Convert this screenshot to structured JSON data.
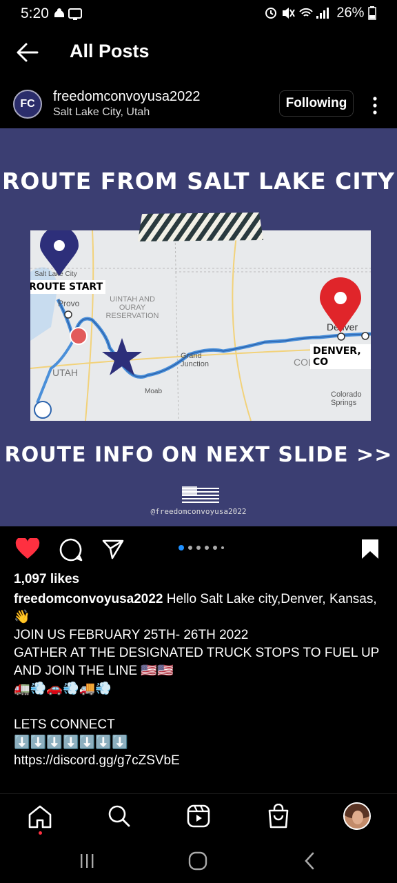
{
  "status_bar": {
    "time": "5:20",
    "battery": "26%"
  },
  "header": {
    "title": "All Posts",
    "back_icon": "arrow-left-icon"
  },
  "post_header": {
    "avatar_initials": "FC",
    "username": "freedomconvoyusa2022",
    "location": "Salt Lake City, Utah",
    "follow_label": "Following",
    "more_icon": "kebab-icon"
  },
  "post_image": {
    "headline_top": "ROUTE FROM SALT LAKE CITY",
    "headline_bottom": "ROUTE INFO ON NEXT SLIDE >>",
    "start_badge": "ROUTE START",
    "end_badge": "DENVER, CO",
    "watermark": "@freedomconvoyusa2022",
    "map_labels": {
      "salt_lake": "Salt Lake City",
      "provo": "Provo",
      "reservation": "UINTAH AND OURAY RESERVATION",
      "utah": "UTAH",
      "grand_junction": "Grand Junction",
      "moab": "Moab",
      "denver": "Denver",
      "colorado": "COLORADO",
      "colorado_springs": "Colorado Springs"
    },
    "colors": {
      "background": "#3b3e72",
      "route": "#4a8fd9",
      "start_pin": "#2d2f7a",
      "end_pin": "#e0252a",
      "star": "#2d2f7a"
    }
  },
  "actions": {
    "like_icon": "heart-icon",
    "comment_icon": "comment-icon",
    "share_icon": "send-icon",
    "save_icon": "bookmark-icon",
    "carousel": {
      "total": 6,
      "active": 1
    }
  },
  "likes": "1,097 likes",
  "caption": {
    "username": "freedomconvoyusa2022",
    "text_line1": "Hello Salt Lake city,Denver, Kansas,",
    "wave": "👋",
    "line2": "JOIN US FEBRUARY 25TH- 26TH 2022",
    "line3": "GATHER AT THE DESIGNATED TRUCK STOPS TO FUEL UP AND JOIN THE LINE 🇺🇸🇺🇸",
    "line4": "🚛💨🚗💨🚚💨",
    "line5": "LETS CONNECT",
    "arrows": "⬇️⬇️⬇️⬇️⬇️⬇️⬇️",
    "link": "https://discord.gg/g7cZSVbE"
  },
  "bottom_nav": [
    "home-icon",
    "search-icon",
    "reels-icon",
    "shop-icon",
    "profile-avatar"
  ],
  "system_nav": [
    "recents-icon",
    "home-button-icon",
    "back-icon"
  ]
}
